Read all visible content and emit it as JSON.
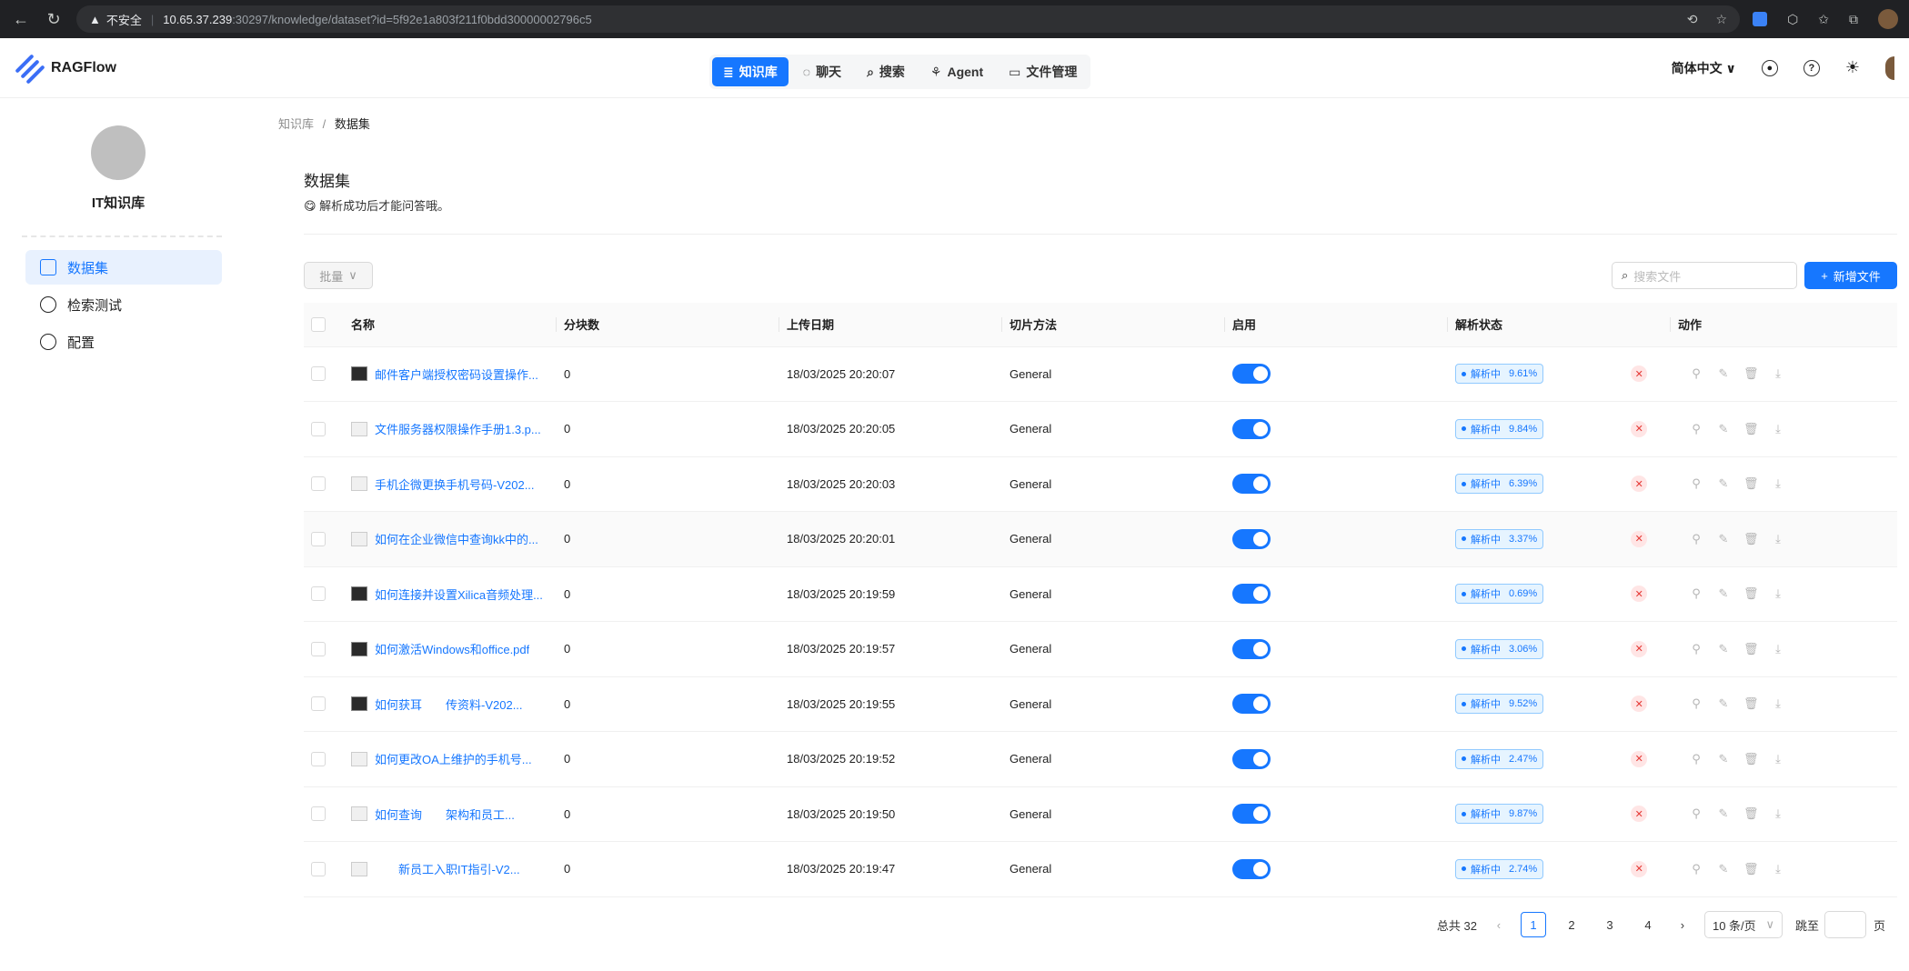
{
  "browser": {
    "insecure_label": "不安全",
    "url_host": "10.65.37.239",
    "url_rest": ":30297/knowledge/dataset?id=5f92e1a803f211f0bdd30000002796c5"
  },
  "header": {
    "brand": "RAGFlow",
    "nav": [
      {
        "label": "知识库",
        "icon": "database-icon"
      },
      {
        "label": "聊天",
        "icon": "chat-icon"
      },
      {
        "label": "搜索",
        "icon": "search-icon"
      },
      {
        "label": "Agent",
        "icon": "agent-icon"
      },
      {
        "label": "文件管理",
        "icon": "folder-icon"
      }
    ],
    "language": "简体中文"
  },
  "sidebar": {
    "kb_name": "IT知识库",
    "items": [
      {
        "label": "数据集",
        "icon": "document-icon"
      },
      {
        "label": "检索测试",
        "icon": "target-icon"
      },
      {
        "label": "配置",
        "icon": "gear-icon"
      }
    ]
  },
  "breadcrumb": {
    "parent": "知识库",
    "separator": "/",
    "current": "数据集"
  },
  "section": {
    "title": "数据集",
    "subtitle": "😋 解析成功后才能问答哦。"
  },
  "toolbar": {
    "batch_label": "批量",
    "search_placeholder": "搜索文件",
    "add_label": "新增文件"
  },
  "table": {
    "headers": [
      "名称",
      "分块数",
      "上传日期",
      "切片方法",
      "启用",
      "解析状态",
      "动作"
    ],
    "rows": [
      {
        "name": "邮件客户端授权密码设置操作...",
        "chunks": "0",
        "date": "18/03/2025 20:20:07",
        "method": "General",
        "status": "解析中",
        "progress": "9.61%",
        "thumb": "dark"
      },
      {
        "name": "文件服务器权限操作手册1.3.p...",
        "chunks": "0",
        "date": "18/03/2025 20:20:05",
        "method": "General",
        "status": "解析中",
        "progress": "9.84%",
        "thumb": "light"
      },
      {
        "name": "手机企微更换手机号码-V202...",
        "chunks": "0",
        "date": "18/03/2025 20:20:03",
        "method": "General",
        "status": "解析中",
        "progress": "6.39%",
        "thumb": "light"
      },
      {
        "name": "如何在企业微信中查询kk中的...",
        "chunks": "0",
        "date": "18/03/2025 20:20:01",
        "method": "General",
        "status": "解析中",
        "progress": "3.37%",
        "thumb": "light"
      },
      {
        "name": "如何连接并设置Xilica音频处理...",
        "chunks": "0",
        "date": "18/03/2025 20:19:59",
        "method": "General",
        "status": "解析中",
        "progress": "0.69%",
        "thumb": "dark"
      },
      {
        "name": "如何激活Windows和office.pdf",
        "chunks": "0",
        "date": "18/03/2025 20:19:57",
        "method": "General",
        "status": "解析中",
        "progress": "3.06%",
        "thumb": "dark"
      },
      {
        "name": "如何获耳　　传资料-V202...",
        "chunks": "0",
        "date": "18/03/2025 20:19:55",
        "method": "General",
        "status": "解析中",
        "progress": "9.52%",
        "thumb": "dark"
      },
      {
        "name": "如何更改OA上维护的手机号...",
        "chunks": "0",
        "date": "18/03/2025 20:19:52",
        "method": "General",
        "status": "解析中",
        "progress": "2.47%",
        "thumb": "light"
      },
      {
        "name": "如何查询　　架构和员工...",
        "chunks": "0",
        "date": "18/03/2025 20:19:50",
        "method": "General",
        "status": "解析中",
        "progress": "9.87%",
        "thumb": "light"
      },
      {
        "name": "　　新员工入职IT指引-V2...",
        "chunks": "0",
        "date": "18/03/2025 20:19:47",
        "method": "General",
        "status": "解析中",
        "progress": "2.74%",
        "thumb": "light"
      }
    ]
  },
  "pagination": {
    "total": "总共 32",
    "pages": [
      "1",
      "2",
      "3",
      "4"
    ],
    "page_size": "10 条/页",
    "jump_label": "跳至",
    "page_suffix": "页"
  }
}
